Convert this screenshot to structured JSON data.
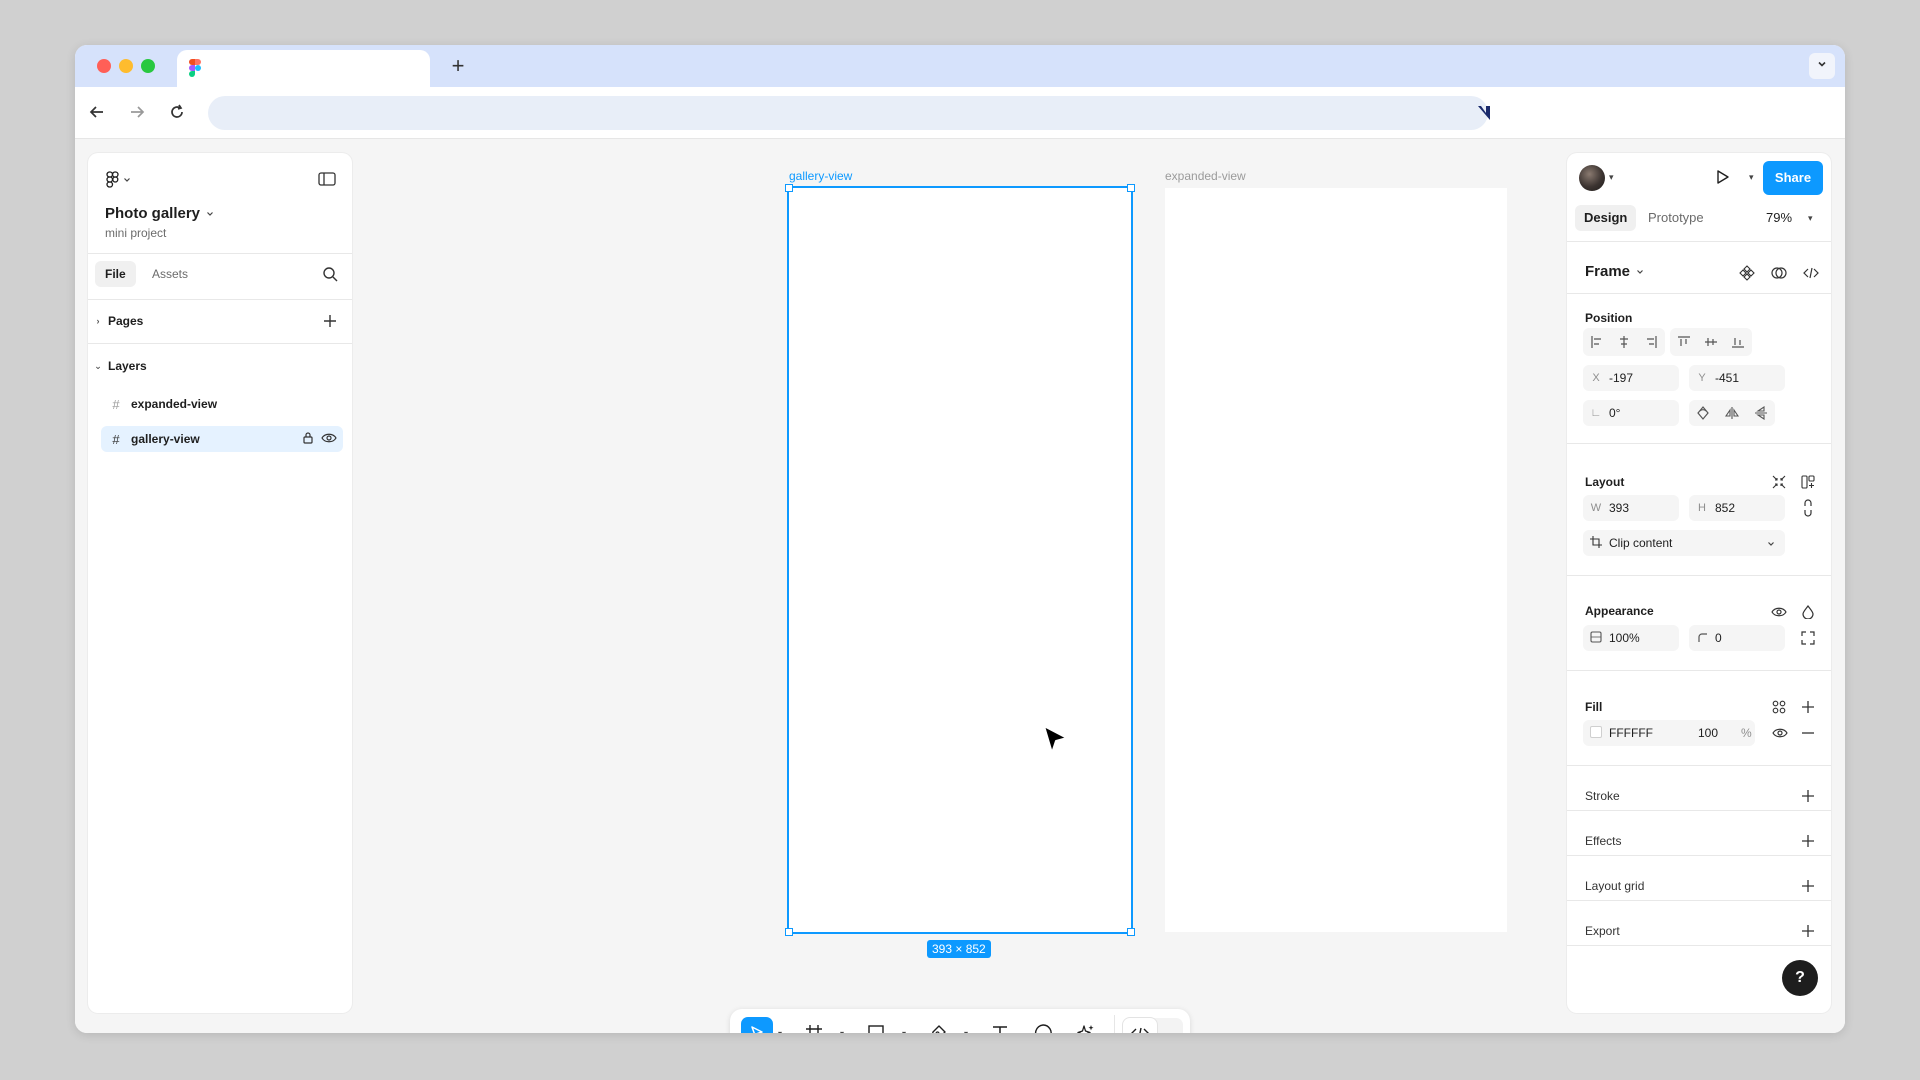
{
  "browser": {
    "new_tab_glyph": "+",
    "tab_menu_glyph": "⌄",
    "favicon": "figma-logo"
  },
  "left_panel": {
    "project_name": "Photo gallery",
    "project_subtitle": "mini project",
    "tabs": [
      {
        "label": "File",
        "active": true
      },
      {
        "label": "Assets",
        "active": false
      }
    ],
    "pages_label": "Pages",
    "layers_label": "Layers",
    "layers": [
      {
        "name": "expanded-view",
        "selected": false
      },
      {
        "name": "gallery-view",
        "selected": true
      }
    ]
  },
  "canvas": {
    "frames": [
      {
        "label": "gallery-view",
        "selected": true
      },
      {
        "label": "expanded-view",
        "selected": false
      }
    ],
    "selection_size": "393 × 852"
  },
  "right_panel": {
    "share_label": "Share",
    "tabs": [
      {
        "label": "Design",
        "active": true
      },
      {
        "label": "Prototype",
        "active": false
      }
    ],
    "zoom": "79%",
    "frame_title": "Frame",
    "position": {
      "title": "Position",
      "x_label": "X",
      "x_value": "-197",
      "y_label": "Y",
      "y_value": "-451",
      "rotation_value": "0°"
    },
    "layout": {
      "title": "Layout",
      "w_label": "W",
      "w_value": "393",
      "h_label": "H",
      "h_value": "852",
      "clip_label": "Clip content"
    },
    "appearance": {
      "title": "Appearance",
      "opacity": "100%",
      "radius": "0"
    },
    "fill": {
      "title": "Fill",
      "hex": "FFFFFF",
      "opacity": "100",
      "percent": "%"
    },
    "sections": [
      "Stroke",
      "Effects",
      "Layout grid",
      "Export"
    ],
    "help_glyph": "?"
  },
  "colors": {
    "accent": "#0d99ff",
    "tabbar": "#d6e2fb",
    "canvas": "#f5f5f5"
  }
}
